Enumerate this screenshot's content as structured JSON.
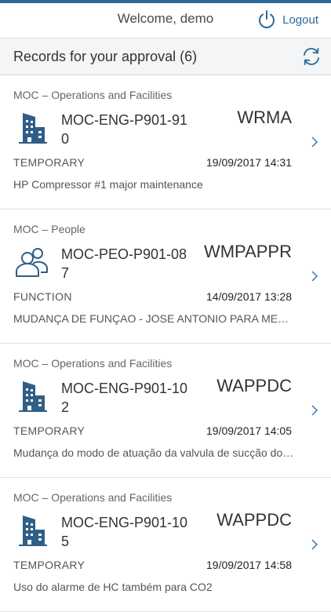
{
  "header": {
    "welcome": "Welcome, demo",
    "logout_label": "Logout",
    "logout_icon": "power-icon"
  },
  "page": {
    "title": "Records for your approval (6)",
    "refresh_icon": "refresh-icon"
  },
  "colors": {
    "accent": "#2b6a96",
    "icon": "#2f5f86",
    "title_bar_bg": "#f4f5f6"
  },
  "records": [
    {
      "category": "MOC – Operations and Facilities",
      "icon": "building-icon",
      "code": "MOC-ENG-P901-910",
      "status": "WRMA",
      "type": "TEMPORARY",
      "date": "19/09/2017 14:31",
      "description": "HP Compressor #1 major maintenance"
    },
    {
      "category": "MOC – People",
      "icon": "people-icon",
      "code": "MOC-PEO-P901-087",
      "status": "WMPAPPR",
      "type": "FUNCTION",
      "date": "14/09/2017 13:28",
      "description": "MUDANÇA DE FUNÇAO - JOSE ANTONIO PARA MECANICO"
    },
    {
      "category": "MOC – Operations and Facilities",
      "icon": "building-icon",
      "code": "MOC-ENG-P901-102",
      "status": "WAPPDC",
      "type": "TEMPORARY",
      "date": "19/09/2017 14:05",
      "description": "Mudança do modo de atuação da valvula de sucção do compressor"
    },
    {
      "category": "MOC – Operations and Facilities",
      "icon": "building-icon",
      "code": "MOC-ENG-P901-105",
      "status": "WAPPDC",
      "type": "TEMPORARY",
      "date": "19/09/2017 14:58",
      "description": "Uso do alarme de HC também para CO2"
    }
  ]
}
